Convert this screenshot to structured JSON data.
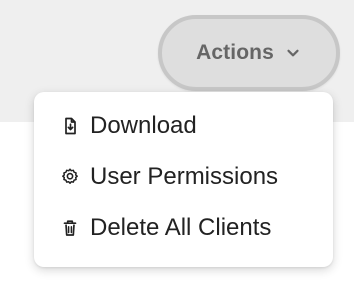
{
  "toolbar": {
    "actions_label": "Actions",
    "actions_icon": "chevron-down-icon"
  },
  "dropdown": {
    "items": [
      {
        "label": "Download",
        "icon": "download-file-icon"
      },
      {
        "label": "User Permissions",
        "icon": "gear-icon"
      },
      {
        "label": "Delete All Clients",
        "icon": "trash-icon"
      }
    ]
  },
  "colors": {
    "page_background": "#efefef",
    "panel_background": "#ffffff",
    "button_background": "#dedede",
    "button_border": "#c7c7c7",
    "button_text": "#666666",
    "menu_text": "#222222"
  }
}
